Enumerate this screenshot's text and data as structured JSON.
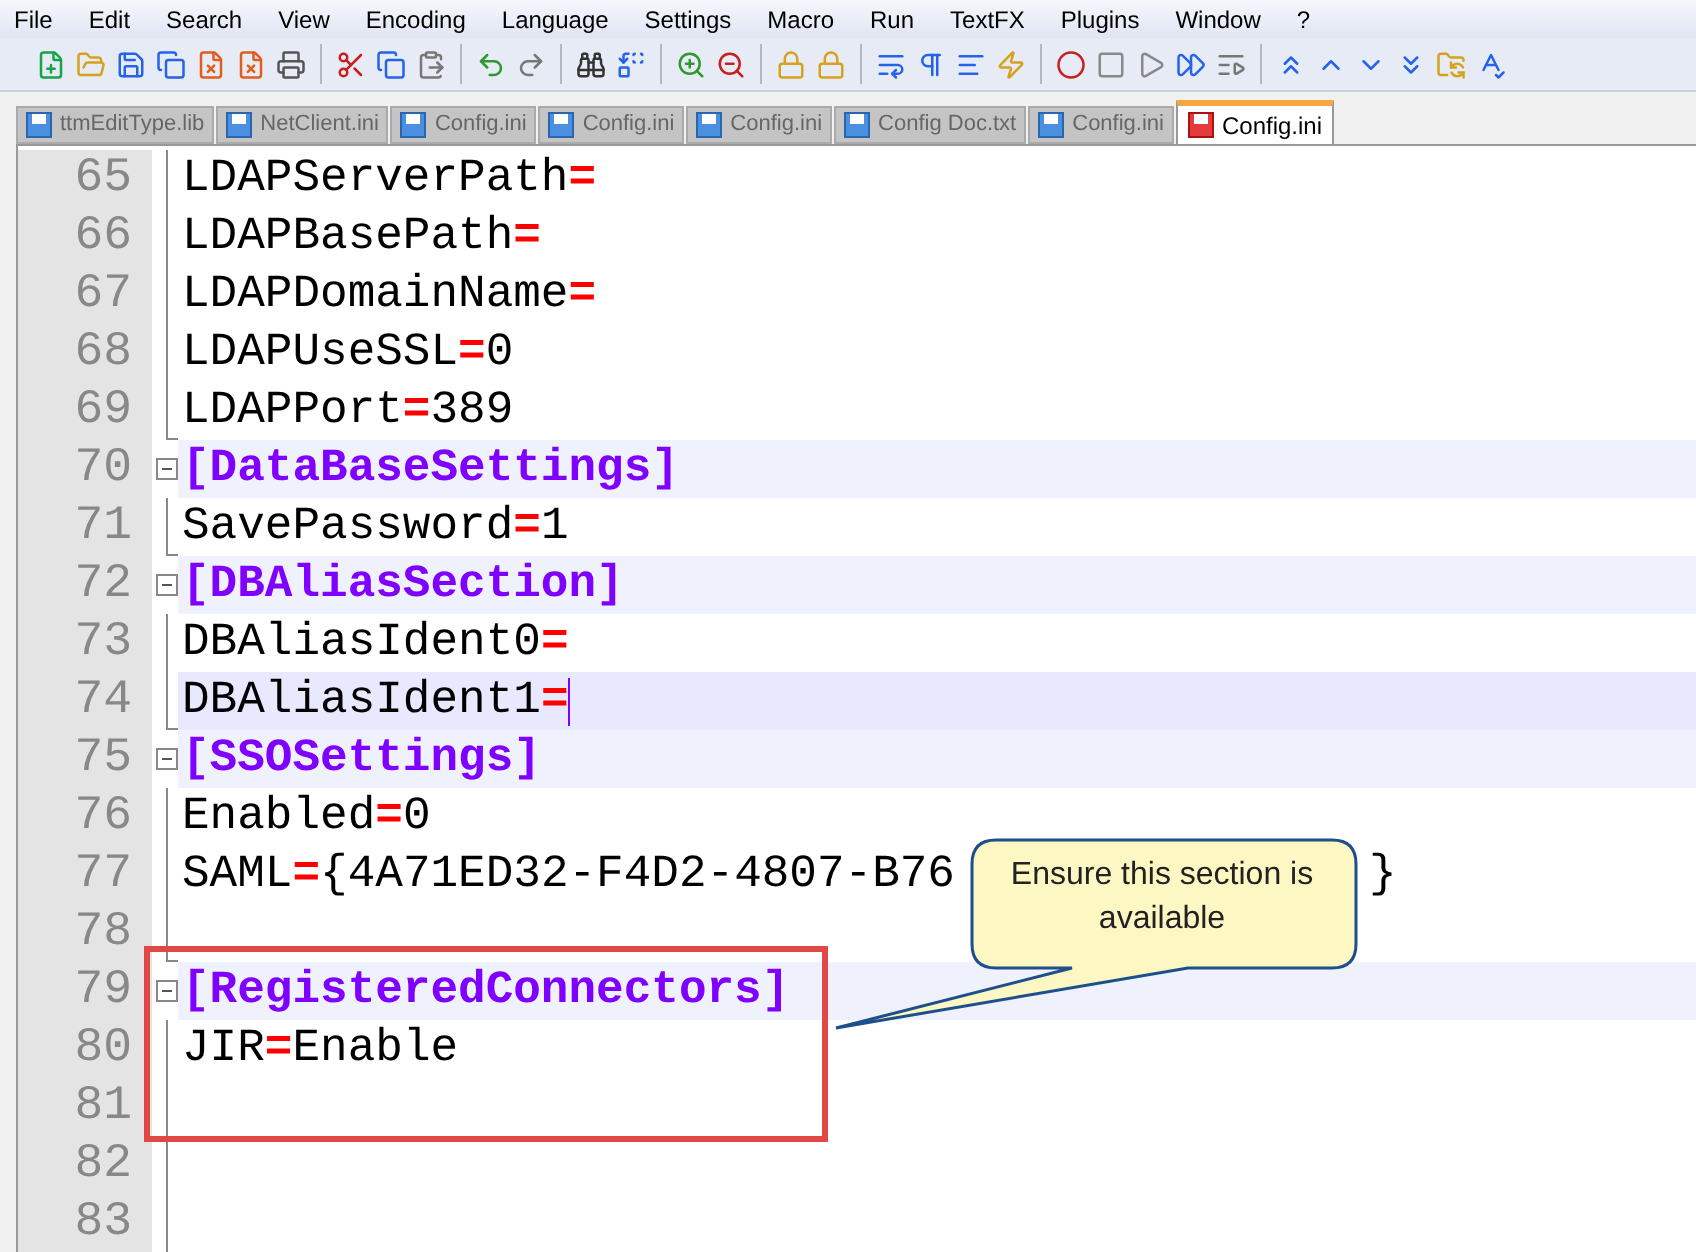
{
  "menu": [
    "File",
    "Edit",
    "Search",
    "View",
    "Encoding",
    "Language",
    "Settings",
    "Macro",
    "Run",
    "TextFX",
    "Plugins",
    "Window",
    "?"
  ],
  "tabs": [
    {
      "label": "ttmEditType.lib",
      "selected": false
    },
    {
      "label": "NetClient.ini",
      "selected": false
    },
    {
      "label": "Config.ini",
      "selected": false
    },
    {
      "label": "Config.ini",
      "selected": false
    },
    {
      "label": "Config.ini",
      "selected": false
    },
    {
      "label": "Config Doc.txt",
      "selected": false
    },
    {
      "label": "Config.ini",
      "selected": false
    },
    {
      "label": "Config.ini",
      "selected": true
    }
  ],
  "lines": [
    {
      "number": "65",
      "kind": "pair",
      "key": "LDAPServerPath",
      "eq": "=",
      "current": false
    },
    {
      "number": "66",
      "kind": "pair",
      "key": "LDAPBasePath",
      "eq": "=",
      "current": false
    },
    {
      "number": "67",
      "kind": "pair",
      "key": "LDAPDomainName",
      "eq": "=",
      "current": false
    },
    {
      "number": "68",
      "kind": "pair",
      "key": "LDAPUseSSL",
      "eq": "=",
      "value": "0",
      "current": false
    },
    {
      "number": "69",
      "kind": "pair",
      "key": "LDAPPort",
      "eq": "=",
      "value": "389",
      "current": false
    },
    {
      "number": "70",
      "kind": "section",
      "text": "[DataBaseSettings]",
      "current": false
    },
    {
      "number": "71",
      "kind": "pair",
      "key": "SavePassword",
      "eq": "=",
      "value": "1",
      "current": false
    },
    {
      "number": "72",
      "kind": "section",
      "text": "[DBAliasSection]",
      "current": false
    },
    {
      "number": "73",
      "kind": "pair",
      "key": "DBAliasIdent0",
      "eq": "=",
      "current": false
    },
    {
      "number": "74",
      "kind": "pair",
      "key": "DBAliasIdent1",
      "eq": "=",
      "current": true
    },
    {
      "number": "75",
      "kind": "section",
      "text": "[SSOSettings]",
      "current": false
    },
    {
      "number": "76",
      "kind": "pair",
      "key": "Enabled",
      "eq": "=",
      "value": "0",
      "current": false
    },
    {
      "number": "77",
      "kind": "pair",
      "key": "SAML",
      "eq": "=",
      "value": "{4A71ED32-F4D2-4807-B76",
      "tail": "}",
      "current": false
    },
    {
      "number": "78",
      "kind": "empty",
      "current": false
    },
    {
      "number": "79",
      "kind": "section",
      "text": "[RegisteredConnectors]",
      "current": false
    },
    {
      "number": "80",
      "kind": "pair",
      "key": "JIR",
      "eq": "=",
      "value": "Enable",
      "current": false
    },
    {
      "number": "81",
      "kind": "empty",
      "current": false
    },
    {
      "number": "82",
      "kind": "empty",
      "current": false
    },
    {
      "number": "83",
      "kind": "empty",
      "current": false
    }
  ],
  "callout": {
    "text": "Ensure this section is available"
  }
}
